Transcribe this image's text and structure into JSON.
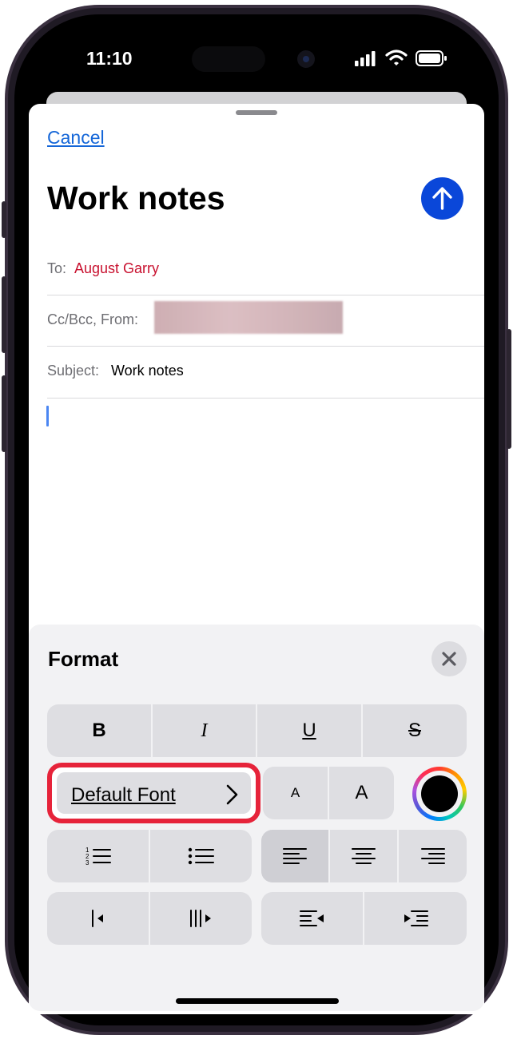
{
  "status_bar": {
    "time": "11:10"
  },
  "compose": {
    "cancel_label": "Cancel",
    "title": "Work notes",
    "to_label": "To:",
    "to_value": "August Garry",
    "ccbcc_label": "Cc/Bcc, From:",
    "subject_label": "Subject:",
    "subject_value": "Work notes"
  },
  "format_panel": {
    "title": "Format",
    "style_buttons": [
      "B",
      "I",
      "U",
      "S"
    ],
    "default_font_label": "Default Font",
    "size_small_label": "A",
    "size_large_label": "A"
  },
  "colors": {
    "accent": "#0a47d9",
    "link": "#1466d8",
    "recipient": "#c8102e",
    "highlight_border": "#e6233a"
  },
  "icons": {
    "send": "arrow-up-icon",
    "close": "close-icon",
    "font_chevron": "chevron-right-icon",
    "color_picker": "color-wheel-icon",
    "numbered_list": "numbered-list-icon",
    "bulleted_list": "bulleted-list-icon",
    "align_left": "align-left-icon",
    "align_center": "align-center-icon",
    "align_right": "align-right-icon",
    "indent_decrease": "indent-decrease-icon",
    "indent_increase": "indent-increase-icon",
    "quote_decrease": "quote-level-decrease-icon",
    "quote_increase": "quote-level-increase-icon"
  }
}
